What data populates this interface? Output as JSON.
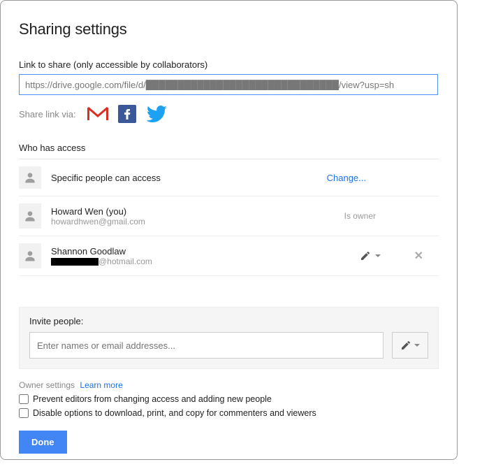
{
  "title": "Sharing settings",
  "link_section": {
    "label": "Link to share (only accessible by collaborators)",
    "url_value": "https://drive.google.com/file/d/██████████████████████████████/view?usp=sh",
    "share_via_label": "Share link via:"
  },
  "access": {
    "section_label": "Who has access",
    "visibility": {
      "text": "Specific people can access",
      "change_label": "Change..."
    },
    "people": [
      {
        "name": "Howard Wen (you)",
        "email": "howardhwen@gmail.com",
        "role_label": "Is owner"
      },
      {
        "name": "Shannon Goodlaw",
        "email_suffix": "@hotmail.com"
      }
    ]
  },
  "invite": {
    "label": "Invite people:",
    "placeholder": "Enter names or email addresses..."
  },
  "owner_settings": {
    "label": "Owner settings",
    "learn_more": "Learn more",
    "checkbox1": "Prevent editors from changing access and adding new people",
    "checkbox2": "Disable options to download, print, and copy for commenters and viewers"
  },
  "buttons": {
    "done": "Done"
  }
}
